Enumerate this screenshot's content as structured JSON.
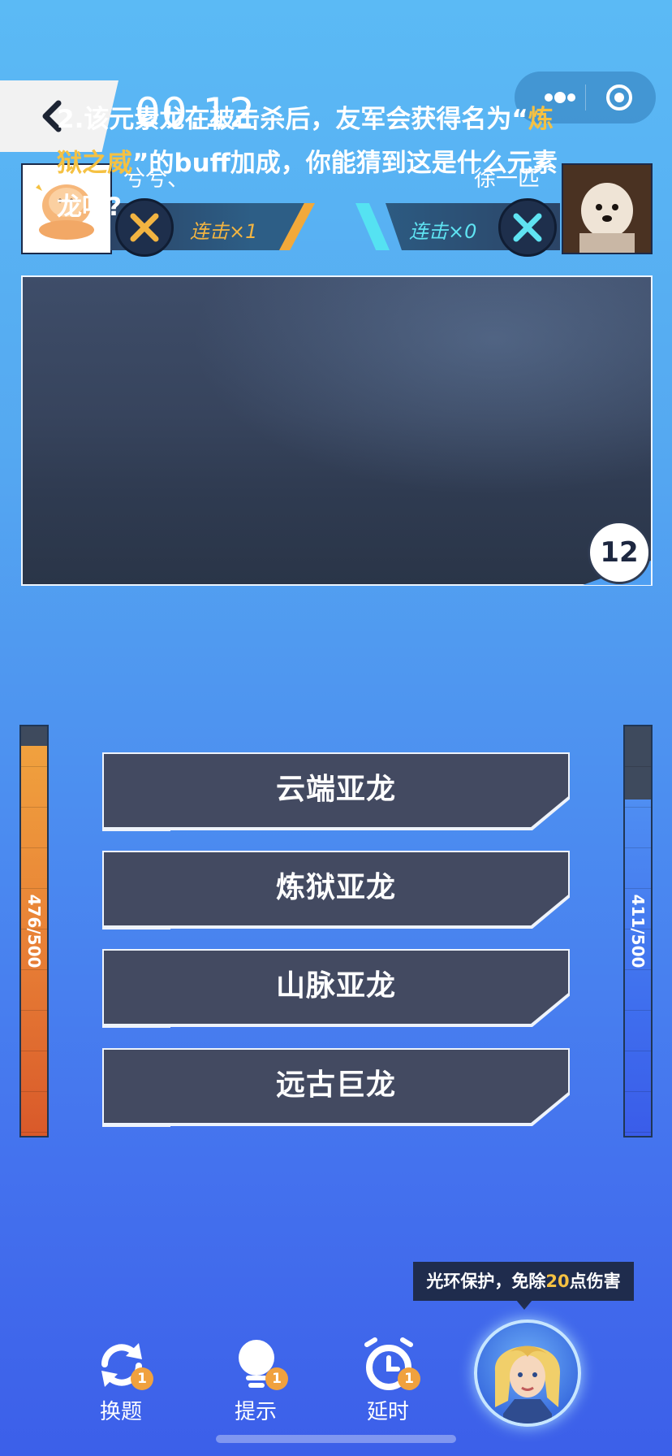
{
  "header": {
    "timer": "00:12"
  },
  "players": {
    "left": {
      "name": "兮兮、",
      "combo": "连击×1"
    },
    "right": {
      "name": "徐一匹",
      "combo": "连击×0"
    }
  },
  "question": {
    "prefix": "2.该元素龙在被击杀后，友军会获得名为“",
    "highlight": "炼狱之威",
    "suffix": "”的buff加成，你能猜到这是什么元素龙吗?",
    "countdown": "12",
    "highlight_color": "#f5c142"
  },
  "options": [
    {
      "label": "云端亚龙"
    },
    {
      "label": "炼狱亚龙"
    },
    {
      "label": "山脉亚龙"
    },
    {
      "label": "远古巨龙"
    }
  ],
  "hp": {
    "left": {
      "label": "476/500",
      "value": 476,
      "max": 500,
      "color": "#e88136"
    },
    "right": {
      "label": "411/500",
      "value": 411,
      "max": 500,
      "color": "#3f6fee"
    }
  },
  "tooltip": {
    "prefix": "光环保护，免除",
    "number": "20",
    "suffix": "点伤害"
  },
  "tools": [
    {
      "label": "换题",
      "badge": "1",
      "icon": "refresh-icon"
    },
    {
      "label": "提示",
      "badge": "1",
      "icon": "lightbulb-icon"
    },
    {
      "label": "延时",
      "badge": "1",
      "icon": "alarm-clock-icon"
    }
  ],
  "icons": {
    "back": "chevron-left-icon",
    "more": "more-dots-icon",
    "close": "target-icon",
    "combo": "crossed-swords-icon",
    "hero": "hero-portrait-icon"
  }
}
